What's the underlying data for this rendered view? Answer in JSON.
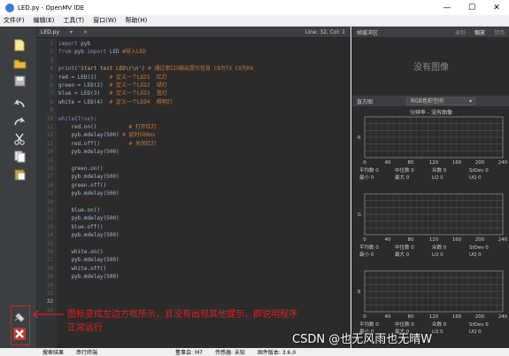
{
  "window": {
    "title": "LED.py - OpenMV IDE",
    "minimize": "—",
    "maximize": "☐",
    "close": "✕"
  },
  "menu": [
    "文件(F)",
    "编辑(E)",
    "工具(T)",
    "窗口(W)",
    "帮助(H)"
  ],
  "editor": {
    "tab": "LED.py",
    "dropdown_arrow": "▾",
    "close": "✕",
    "line_col": "Line: 32, Col: 1"
  },
  "code_lines": [
    {
      "n": "1",
      "parts": [
        [
          "kw",
          "import "
        ],
        [
          "plain",
          "pyb"
        ]
      ]
    },
    {
      "n": "2",
      "parts": [
        [
          "kw",
          "from "
        ],
        [
          "plain",
          "pyb "
        ],
        [
          "kw",
          "import "
        ],
        [
          "plain",
          "LED "
        ],
        [
          "cmt",
          "#导入LED"
        ]
      ]
    },
    {
      "n": "3",
      "parts": []
    },
    {
      "n": "4",
      "parts": [
        [
          "fn",
          "print"
        ],
        [
          "plain",
          "("
        ],
        [
          "str",
          "'Start test LED\\r\\n'"
        ],
        [
          "plain",
          ") "
        ],
        [
          "cmt",
          "# 通过串口3输出提示信息 C8为TX C9为RX"
        ]
      ]
    },
    {
      "n": "5",
      "parts": [
        [
          "plain",
          "red = LED(1)    "
        ],
        [
          "cmt",
          "# 定义一个LED1  红灯"
        ]
      ]
    },
    {
      "n": "6",
      "parts": [
        [
          "plain",
          "green = LED(2)  "
        ],
        [
          "cmt",
          "# 定义一个LED2  绿灯"
        ]
      ]
    },
    {
      "n": "7",
      "parts": [
        [
          "plain",
          "blue = LED(3)   "
        ],
        [
          "cmt",
          "# 定义一个LED3  蓝灯"
        ]
      ]
    },
    {
      "n": "8",
      "parts": [
        [
          "plain",
          "white = LED(4)  "
        ],
        [
          "cmt",
          "# 定义一个LED4  照明灯"
        ]
      ]
    },
    {
      "n": "9",
      "parts": []
    },
    {
      "n": "10",
      "parts": [
        [
          "kw",
          "while"
        ],
        [
          "plain",
          "("
        ],
        [
          "kw",
          "True"
        ],
        [
          "plain",
          "):"
        ]
      ]
    },
    {
      "n": "11",
      "parts": [
        [
          "plain",
          "    red.on()          "
        ],
        [
          "cmt",
          "# 打开红灯"
        ]
      ]
    },
    {
      "n": "12",
      "parts": [
        [
          "plain",
          "    pyb.mdelay(500) "
        ],
        [
          "cmt",
          "# 延时500ms"
        ]
      ]
    },
    {
      "n": "13",
      "parts": [
        [
          "plain",
          "    red.off()         "
        ],
        [
          "cmt",
          "# 关闭红灯"
        ]
      ]
    },
    {
      "n": "14",
      "parts": [
        [
          "plain",
          "    pyb.mdelay(500)"
        ]
      ]
    },
    {
      "n": "15",
      "parts": []
    },
    {
      "n": "16",
      "parts": [
        [
          "plain",
          "    green.on()"
        ]
      ]
    },
    {
      "n": "17",
      "parts": [
        [
          "plain",
          "    pyb.mdelay(500)"
        ]
      ]
    },
    {
      "n": "18",
      "parts": [
        [
          "plain",
          "    green.off()"
        ]
      ]
    },
    {
      "n": "19",
      "parts": [
        [
          "plain",
          "    pyb.mdelay(500)"
        ]
      ]
    },
    {
      "n": "20",
      "parts": []
    },
    {
      "n": "21",
      "parts": [
        [
          "plain",
          "    blue.on()"
        ]
      ]
    },
    {
      "n": "22",
      "parts": [
        [
          "plain",
          "    pyb.mdelay(500)"
        ]
      ]
    },
    {
      "n": "23",
      "parts": [
        [
          "plain",
          "    blue.off()"
        ]
      ]
    },
    {
      "n": "24",
      "parts": [
        [
          "plain",
          "    pyb.mdelay(500)"
        ]
      ]
    },
    {
      "n": "25",
      "parts": []
    },
    {
      "n": "26",
      "parts": [
        [
          "plain",
          "    white.on()"
        ]
      ]
    },
    {
      "n": "27",
      "parts": [
        [
          "plain",
          "    pyb.mdelay(500)"
        ]
      ]
    },
    {
      "n": "28",
      "parts": [
        [
          "plain",
          "    white.off()"
        ]
      ]
    },
    {
      "n": "29",
      "parts": [
        [
          "plain",
          "    pyb.mdelay(500)"
        ]
      ]
    },
    {
      "n": "30",
      "parts": []
    },
    {
      "n": "31",
      "parts": []
    },
    {
      "n": "32",
      "parts": []
    },
    {
      "n": "33",
      "parts": []
    }
  ],
  "framebuffer": {
    "title": "帧缓冲区",
    "buttons": [
      "录制",
      "缩放",
      "禁用"
    ],
    "active_button": "缩放",
    "empty_text": "没有图像"
  },
  "histogram": {
    "title": "直方图",
    "colorspace": "RGB色彩空间",
    "colorspace_arrow": "▾",
    "resolution_label": "分辨率 - 没有图像",
    "x_ticks": [
      "0",
      "40",
      "80",
      "120",
      "160",
      "200",
      "240"
    ],
    "stats_row1": [
      "平均数 0",
      "中位数 0",
      "众数 0",
      "StDev 0"
    ],
    "stats_row2": [
      "最小 0",
      "最大 0",
      "LQ 0",
      "UQ 0"
    ],
    "channel_labels": [
      "R",
      "G",
      "B"
    ]
  },
  "status": {
    "items": [
      "搜索结果",
      "串行终端",
      "",
      "董事会: M7",
      "传感器: 未知",
      "固件版本: 3.6.0"
    ]
  },
  "annotation": {
    "line1": "图标变成左边方框所示，且没有出现其他提示，即说明程序",
    "line2": "正常运行"
  },
  "watermark": "CSDN @也无风雨也无晴W",
  "colors": {
    "editor_bg": "#2b2b2b",
    "toolbar_bg": "#3c3f41",
    "annotation": "#e02020"
  }
}
